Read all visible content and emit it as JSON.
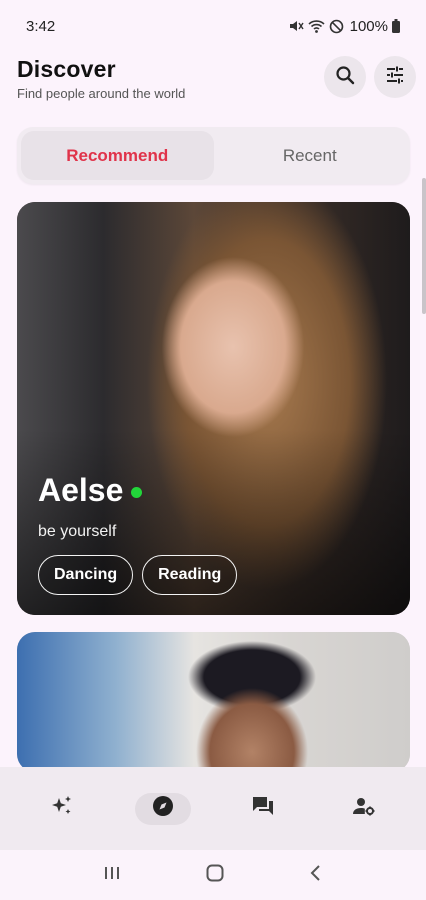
{
  "status_bar": {
    "time": "3:42",
    "battery_percent": "100%"
  },
  "header": {
    "title": "Discover",
    "subtitle": "Find people around the world",
    "search_icon": "search-icon",
    "filter_icon": "sliders-icon"
  },
  "tabs": [
    {
      "label": "Recommend",
      "active": true
    },
    {
      "label": "Recent",
      "active": false
    }
  ],
  "cards": [
    {
      "name": "Aelse",
      "online": true,
      "bio": "be yourself",
      "tags": [
        "Dancing",
        "Reading"
      ]
    },
    {
      "name": "",
      "bio": "",
      "tags": []
    }
  ],
  "bottom_nav": [
    {
      "icon": "sparkles-icon",
      "active": false
    },
    {
      "icon": "compass-icon",
      "active": true
    },
    {
      "icon": "chat-icon",
      "active": false
    },
    {
      "icon": "user-settings-icon",
      "active": false
    }
  ],
  "colors": {
    "accent": "#e0334a",
    "online": "#22d63a",
    "background": "#fcf3fc"
  }
}
